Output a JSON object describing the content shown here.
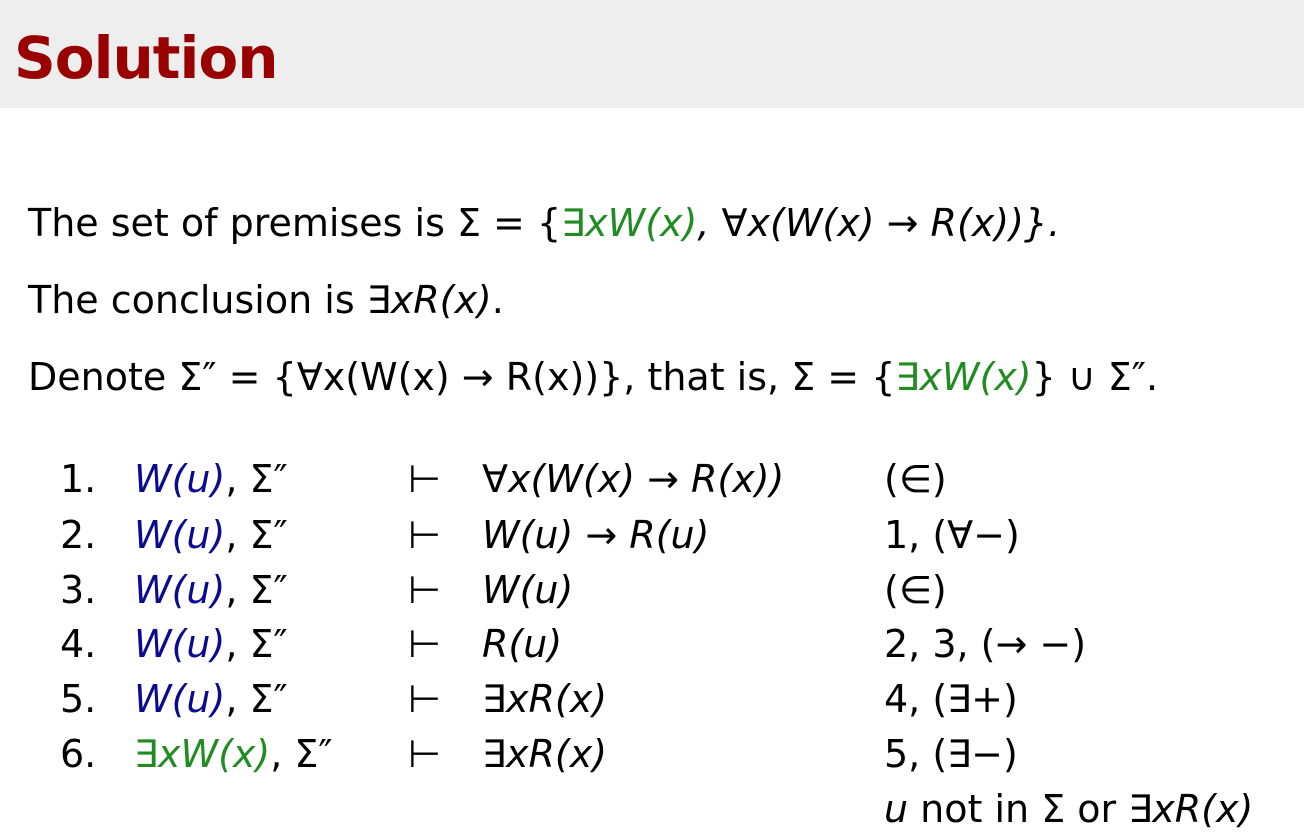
{
  "slide": {
    "title": "Solution"
  },
  "statements": {
    "premises": {
      "prefix": "The set of premises is Σ = {",
      "green_part": "∃xW(x)",
      "suffix": ", ∀x(W(x) → R(x))}."
    },
    "conclusion": {
      "prefix": "The conclusion is ",
      "formula": "∃xR(x)",
      "suffix": "."
    },
    "denote": {
      "prefix": "Denote Σ″ = {∀x(W(x) → R(x))}, that is, Σ = {",
      "green_part": "∃xW(x)",
      "suffix": "} ∪ Σ″."
    }
  },
  "proof": {
    "rows": [
      {
        "num": "1.",
        "ctx_main": "W(u)",
        "ctx_rest": ", Σ″",
        "ctx_color": "blue",
        "turnstile": "⊢",
        "formula": "∀x(W(x) → R(x))",
        "rule": "(∈)"
      },
      {
        "num": "2.",
        "ctx_main": "W(u)",
        "ctx_rest": ", Σ″",
        "ctx_color": "blue",
        "turnstile": "⊢",
        "formula": "W(u) → R(u)",
        "rule": "1, (∀−)"
      },
      {
        "num": "3.",
        "ctx_main": "W(u)",
        "ctx_rest": ", Σ″",
        "ctx_color": "blue",
        "turnstile": "⊢",
        "formula": "W(u)",
        "rule": "(∈)"
      },
      {
        "num": "4.",
        "ctx_main": "W(u)",
        "ctx_rest": ", Σ″",
        "ctx_color": "blue",
        "turnstile": "⊢",
        "formula": "R(u)",
        "rule": "2, 3, (→ −)"
      },
      {
        "num": "5.",
        "ctx_main": "W(u)",
        "ctx_rest": ", Σ″",
        "ctx_color": "blue",
        "turnstile": "⊢",
        "formula": "∃xR(x)",
        "rule": "4, (∃+)"
      },
      {
        "num": "6.",
        "ctx_main": "∃xW(x)",
        "ctx_rest": ", Σ″",
        "ctx_color": "green",
        "turnstile": "⊢",
        "formula": "∃xR(x)",
        "rule": "5, (∃−)"
      }
    ],
    "note": {
      "var": "u",
      "text": " not in Σ or ",
      "formula": "∃xR(x)"
    }
  },
  "colors": {
    "title": "#990000",
    "title_bar": "#eeeeee",
    "green": "#228b22",
    "blue": "#0b0b8f"
  }
}
